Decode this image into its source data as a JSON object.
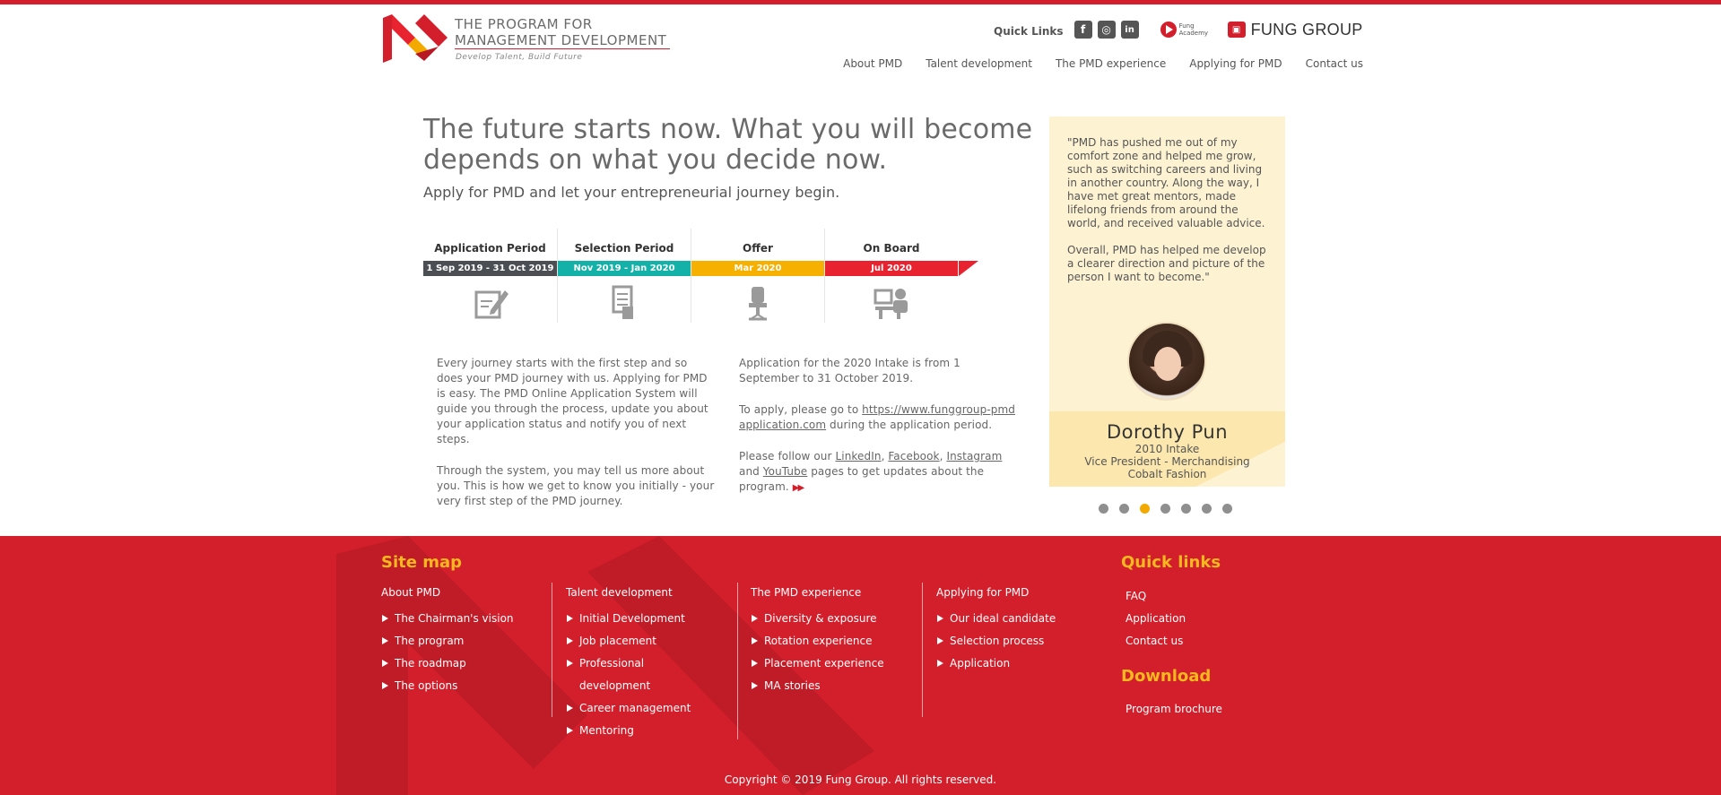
{
  "brand": {
    "title_line1": "THE PROGRAM FOR",
    "title_line2": "MANAGEMENT DEVELOPMENT",
    "tagline": "Develop Talent, Build Future"
  },
  "quick_links": {
    "label": "Quick Links",
    "social": [
      {
        "name": "facebook",
        "glyph": "f"
      },
      {
        "name": "instagram",
        "glyph": "◎"
      },
      {
        "name": "linkedin",
        "glyph": "in"
      }
    ],
    "fung_academy": "Fung Academy",
    "fung_group": "FUNG GROUP"
  },
  "nav": [
    "About PMD",
    "Talent development",
    "The PMD experience",
    "Applying for PMD",
    "Contact us"
  ],
  "hero": {
    "title": "The future starts now. What you will become depends on what you decide now.",
    "subtitle": "Apply for PMD and let your entrepreneurial journey begin."
  },
  "timeline": [
    {
      "title": "Application Period",
      "dates": "1 Sep 2019  - 31 Oct 2019",
      "color": "#4b4f54",
      "icon": "form-icon"
    },
    {
      "title": "Selection Period",
      "dates": "Nov 2019 - Jan 2020",
      "color": "#13b1a8",
      "icon": "document-icon"
    },
    {
      "title": "Offer",
      "dates": "Mar 2020",
      "color": "#f5b000",
      "icon": "chair-icon"
    },
    {
      "title": "On Board",
      "dates": "Jul 2020",
      "color": "#e8222f",
      "icon": "desk-worker-icon"
    }
  ],
  "body_left": {
    "p1": "Every journey starts with the first step and so does your PMD journey with us. Applying for PMD is easy. The PMD Online Application System will guide you through the process, update you about your application status and notify you of next steps.",
    "p2": "Through the system, you may tell us more about you. This is how we get to know you initially - your very first step of the PMD journey."
  },
  "body_right": {
    "p1": "Application for the 2020 Intake is from 1 September to 31 October 2019.",
    "p2_pre": "To apply, please go to ",
    "p2_link": "https://www.funggroup-pmdapplication.com",
    "p2_post": " during the application period.",
    "p3_pre": "Please follow our ",
    "p3_linkedin": "LinkedIn",
    "p3_facebook": "Facebook",
    "p3_instagram": "Instagram",
    "p3_and": " and ",
    "p3_youtube": "YouTube",
    "p3_post": " pages to get updates about the program."
  },
  "testimonial": {
    "quote1": "\"PMD has pushed me out of my comfort zone and helped me grow, such as switching careers and living in another country. Along the way, I have met great mentors, made lifelong friends from around the world, and received valuable advice.",
    "quote2": "Overall, PMD has helped me develop a clearer direction and picture of the person I want to become.\"",
    "name": "Dorothy Pun",
    "intake": "2010 Intake",
    "role": "Vice President - Merchandising",
    "company": "Cobalt Fashion",
    "active_slide": 3,
    "total_slides": 7
  },
  "footer": {
    "sitemap_heading": "Site map",
    "quicklinks_heading": "Quick links",
    "download_heading": "Download",
    "columns": [
      {
        "title": "About PMD",
        "items": [
          "The Chairman's vision",
          "The program",
          "The roadmap",
          "The options"
        ]
      },
      {
        "title": "Talent development",
        "items": [
          "Initial Development",
          "Job placement",
          "Professional development",
          "Career management",
          "Mentoring"
        ]
      },
      {
        "title": "The PMD experience",
        "items": [
          "Diversity & exposure",
          "Rotation experience",
          "Placement experience",
          "MA stories"
        ]
      },
      {
        "title": "Applying for PMD",
        "items": [
          "Our ideal candidate",
          "Selection process",
          "Application"
        ]
      }
    ],
    "quick_links": [
      "FAQ",
      "Application",
      "Contact us"
    ],
    "download": [
      "Program brochure"
    ],
    "copyright": "Copyright © 2019 Fung Group. All rights reserved."
  }
}
